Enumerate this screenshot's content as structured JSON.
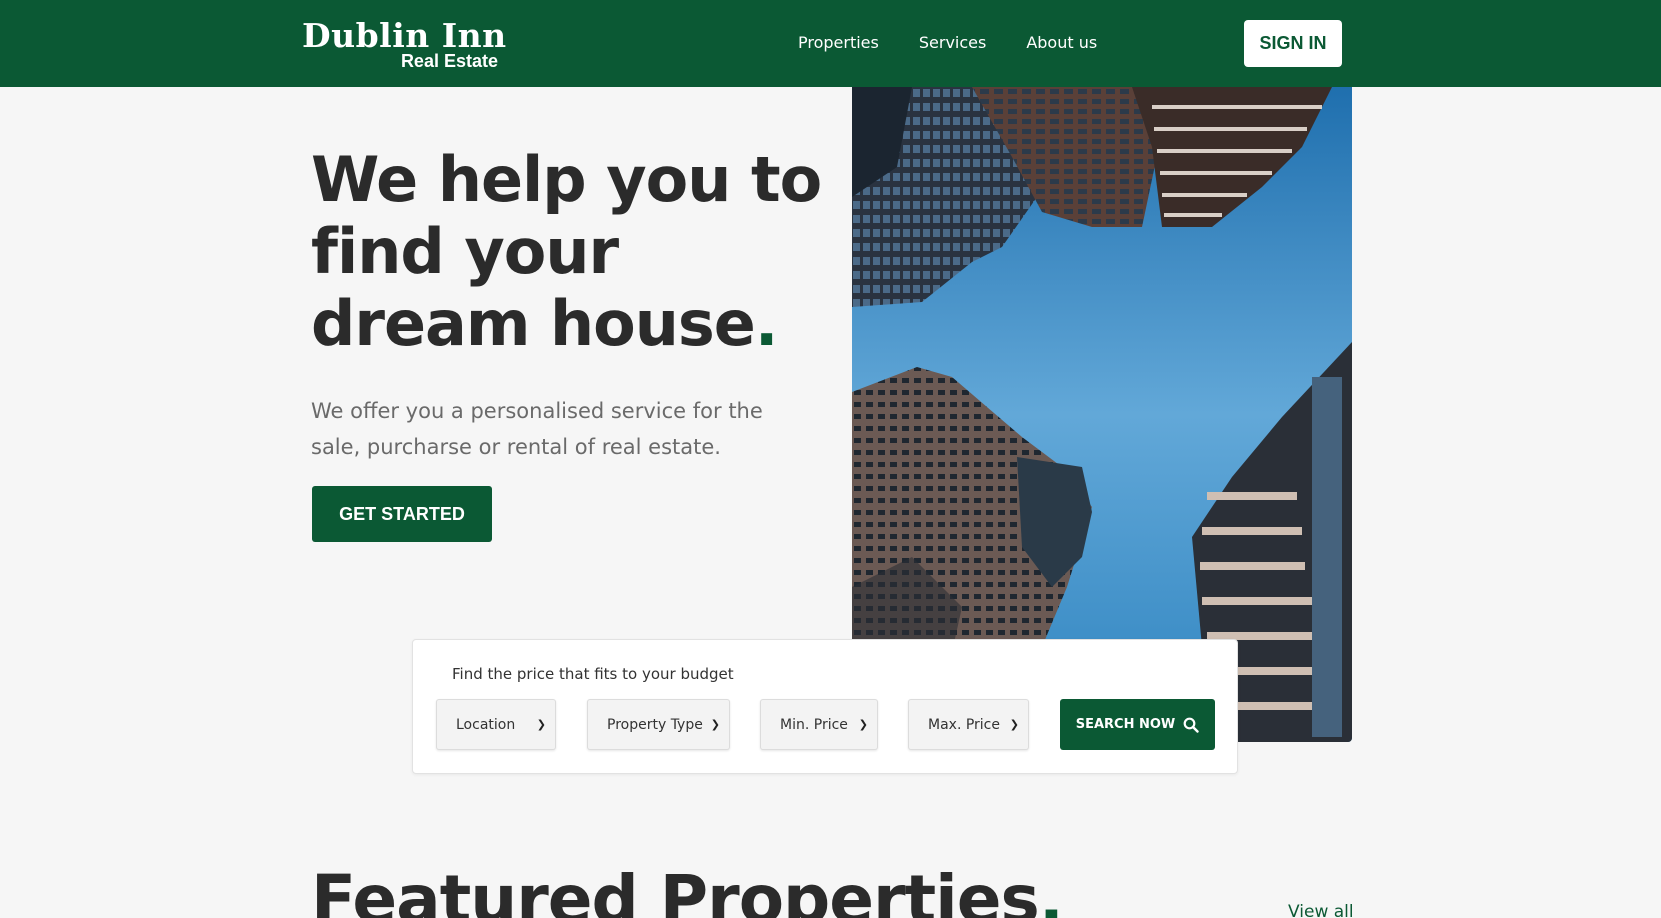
{
  "brand": {
    "name": "Dublin Inn",
    "tagline": "Real Estate"
  },
  "nav": {
    "items": [
      "Properties",
      "Services",
      "About us"
    ],
    "sign_in": "SIGN IN"
  },
  "hero": {
    "title_line1": "We help you to",
    "title_line2": "find your",
    "title_line3": "dream house",
    "title_dot": ".",
    "subtitle": "We offer you a personalised service for the sale, purcharse or rental of real estate.",
    "cta": "GET STARTED"
  },
  "search": {
    "label": "Find the price that fits to your budget",
    "selects": [
      "Location",
      "Property Type",
      "Min. Price",
      "Max. Price"
    ],
    "button": "SEARCH NOW"
  },
  "featured": {
    "title": "Featured Properties",
    "dot": ".",
    "view_all": "View all"
  },
  "colors": {
    "brand_green": "#0b5934",
    "background": "#f6f6f6",
    "sky_blue": "#3c8fc9"
  },
  "icons": {
    "search": "search-icon",
    "select_arrow": "chevron-down-icon"
  }
}
